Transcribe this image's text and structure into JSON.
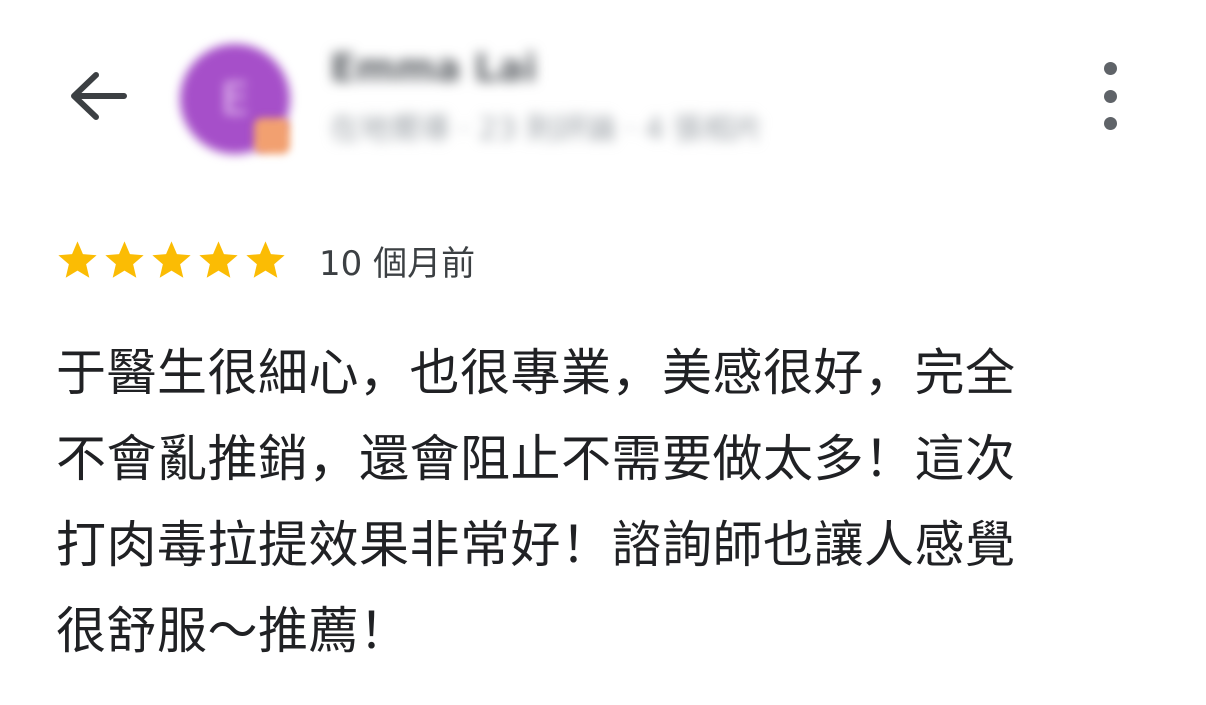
{
  "header": {
    "reviewer_name": "Emma Lai",
    "reviewer_meta": "在地嚮導 · 23 則評論 · 4 張相片",
    "avatar_letter": "E",
    "avatar_color": "#a64fc9"
  },
  "rating": {
    "stars": 5,
    "max_stars": 5,
    "star_color": "#fbbc04",
    "time_ago": "10 個月前"
  },
  "review": {
    "lines": [
      "于醫生很細心，也很專業，美感很好，完全",
      "不會亂推銷，還會阻止不需要做太多！這次",
      "打肉毒拉提效果非常好！諮詢師也讓人感覺",
      "很舒服～推薦！"
    ]
  },
  "icons": {
    "back": "arrow-back-icon",
    "more": "more-vert-icon",
    "star": "star-icon"
  }
}
